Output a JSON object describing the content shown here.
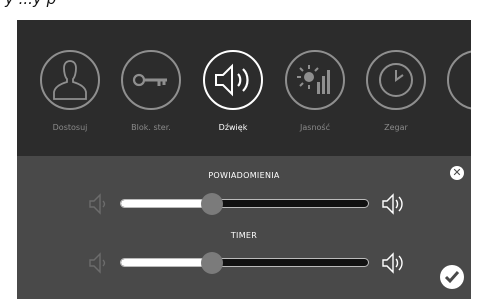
{
  "top_text": "y   ...y   p",
  "menu": {
    "items": [
      {
        "label": "Dostosuj",
        "icon": "person-icon"
      },
      {
        "label": "Blok. ster.",
        "icon": "key-icon"
      },
      {
        "label": "Dźwięk",
        "icon": "speaker-icon",
        "active": true
      },
      {
        "label": "Jasność",
        "icon": "brightness-icon"
      },
      {
        "label": "Zegar",
        "icon": "clock-icon"
      }
    ]
  },
  "sound_panel": {
    "sliders": [
      {
        "title": "POWIADOMIENIA",
        "value_percent": 37
      },
      {
        "title": "TIMER",
        "value_percent": 37
      }
    ],
    "close_icon": "close-icon",
    "confirm_icon": "checkmark-icon"
  },
  "colors": {
    "menu_bg": "#2c2c2c",
    "panel_bg": "#494949",
    "active": "#ffffff",
    "inactive": "#8a8a8a"
  }
}
